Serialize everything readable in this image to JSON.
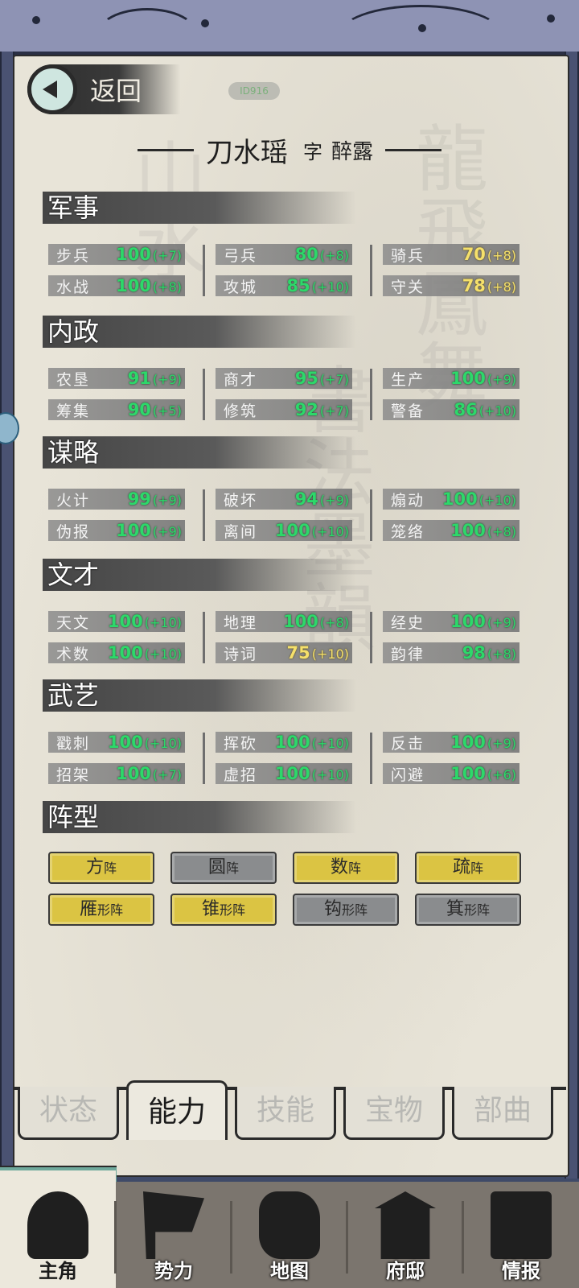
{
  "header": {
    "back_label": "返回",
    "badge_text": "ID916"
  },
  "character": {
    "name": "刀水瑶",
    "zi_label": "字",
    "courtesy_name": "醉露"
  },
  "sections": {
    "military": {
      "title": "军事",
      "stats": [
        {
          "name": "步兵",
          "value": "100",
          "bonus": "(+7)",
          "color": "green"
        },
        {
          "name": "弓兵",
          "value": "80",
          "bonus": "(+8)",
          "color": "green"
        },
        {
          "name": "骑兵",
          "value": "70",
          "bonus": "(+8)",
          "color": "yellow"
        },
        {
          "name": "水战",
          "value": "100",
          "bonus": "(+8)",
          "color": "green"
        },
        {
          "name": "攻城",
          "value": "85",
          "bonus": "(+10)",
          "color": "green"
        },
        {
          "name": "守关",
          "value": "78",
          "bonus": "(+8)",
          "color": "yellow"
        }
      ]
    },
    "politics": {
      "title": "内政",
      "stats": [
        {
          "name": "农垦",
          "value": "91",
          "bonus": "(+9)",
          "color": "green"
        },
        {
          "name": "商才",
          "value": "95",
          "bonus": "(+7)",
          "color": "green"
        },
        {
          "name": "生产",
          "value": "100",
          "bonus": "(+9)",
          "color": "green"
        },
        {
          "name": "筹集",
          "value": "90",
          "bonus": "(+5)",
          "color": "green"
        },
        {
          "name": "修筑",
          "value": "92",
          "bonus": "(+7)",
          "color": "green"
        },
        {
          "name": "警备",
          "value": "86",
          "bonus": "(+10)",
          "color": "green"
        }
      ]
    },
    "strategy": {
      "title": "谋略",
      "stats": [
        {
          "name": "火计",
          "value": "99",
          "bonus": "(+9)",
          "color": "green"
        },
        {
          "name": "破坏",
          "value": "94",
          "bonus": "(+9)",
          "color": "green"
        },
        {
          "name": "煽动",
          "value": "100",
          "bonus": "(+10)",
          "color": "green"
        },
        {
          "name": "伪报",
          "value": "100",
          "bonus": "(+9)",
          "color": "green"
        },
        {
          "name": "离间",
          "value": "100",
          "bonus": "(+10)",
          "color": "green"
        },
        {
          "name": "笼络",
          "value": "100",
          "bonus": "(+8)",
          "color": "green"
        }
      ]
    },
    "literary": {
      "title": "文才",
      "stats": [
        {
          "name": "天文",
          "value": "100",
          "bonus": "(+10)",
          "color": "green"
        },
        {
          "name": "地理",
          "value": "100",
          "bonus": "(+8)",
          "color": "green"
        },
        {
          "name": "经史",
          "value": "100",
          "bonus": "(+9)",
          "color": "green"
        },
        {
          "name": "术数",
          "value": "100",
          "bonus": "(+10)",
          "color": "green"
        },
        {
          "name": "诗词",
          "value": "75",
          "bonus": "(+10)",
          "color": "yellow"
        },
        {
          "name": "韵律",
          "value": "98",
          "bonus": "(+8)",
          "color": "green"
        }
      ]
    },
    "martial": {
      "title": "武艺",
      "stats": [
        {
          "name": "戳刺",
          "value": "100",
          "bonus": "(+10)",
          "color": "green"
        },
        {
          "name": "挥砍",
          "value": "100",
          "bonus": "(+10)",
          "color": "green"
        },
        {
          "name": "反击",
          "value": "100",
          "bonus": "(+9)",
          "color": "green"
        },
        {
          "name": "招架",
          "value": "100",
          "bonus": "(+7)",
          "color": "green"
        },
        {
          "name": "虚招",
          "value": "100",
          "bonus": "(+10)",
          "color": "green"
        },
        {
          "name": "闪避",
          "value": "100",
          "bonus": "(+6)",
          "color": "green"
        }
      ]
    },
    "formation": {
      "title": "阵型",
      "items": [
        {
          "main": "方",
          "suffix": "阵",
          "enabled": true
        },
        {
          "main": "圆",
          "suffix": "阵",
          "enabled": false
        },
        {
          "main": "数",
          "suffix": "阵",
          "enabled": true
        },
        {
          "main": "疏",
          "suffix": "阵",
          "enabled": true
        },
        {
          "main": "雁",
          "suffix": "形阵",
          "enabled": true
        },
        {
          "main": "锥",
          "suffix": "形阵",
          "enabled": true
        },
        {
          "main": "钩",
          "suffix": "形阵",
          "enabled": false
        },
        {
          "main": "箕",
          "suffix": "形阵",
          "enabled": false
        }
      ]
    }
  },
  "sub_tabs": [
    {
      "label": "状态",
      "active": false
    },
    {
      "label": "能力",
      "active": true
    },
    {
      "label": "技能",
      "active": false
    },
    {
      "label": "宝物",
      "active": false
    },
    {
      "label": "部曲",
      "active": false
    }
  ],
  "bottom_nav": [
    {
      "label": "主角",
      "icon": "hero-portrait-icon",
      "active": true
    },
    {
      "label": "势力",
      "icon": "flag-icon",
      "active": false
    },
    {
      "label": "地图",
      "icon": "map-icon",
      "active": false
    },
    {
      "label": "府邸",
      "icon": "mansion-icon",
      "active": false
    },
    {
      "label": "情报",
      "icon": "scroll-icon",
      "active": false
    }
  ],
  "colors": {
    "green_value": "#2dd86a",
    "yellow_value": "#f5e06b",
    "formation_on": "#dbc443",
    "formation_off": "#8a8c8e"
  }
}
